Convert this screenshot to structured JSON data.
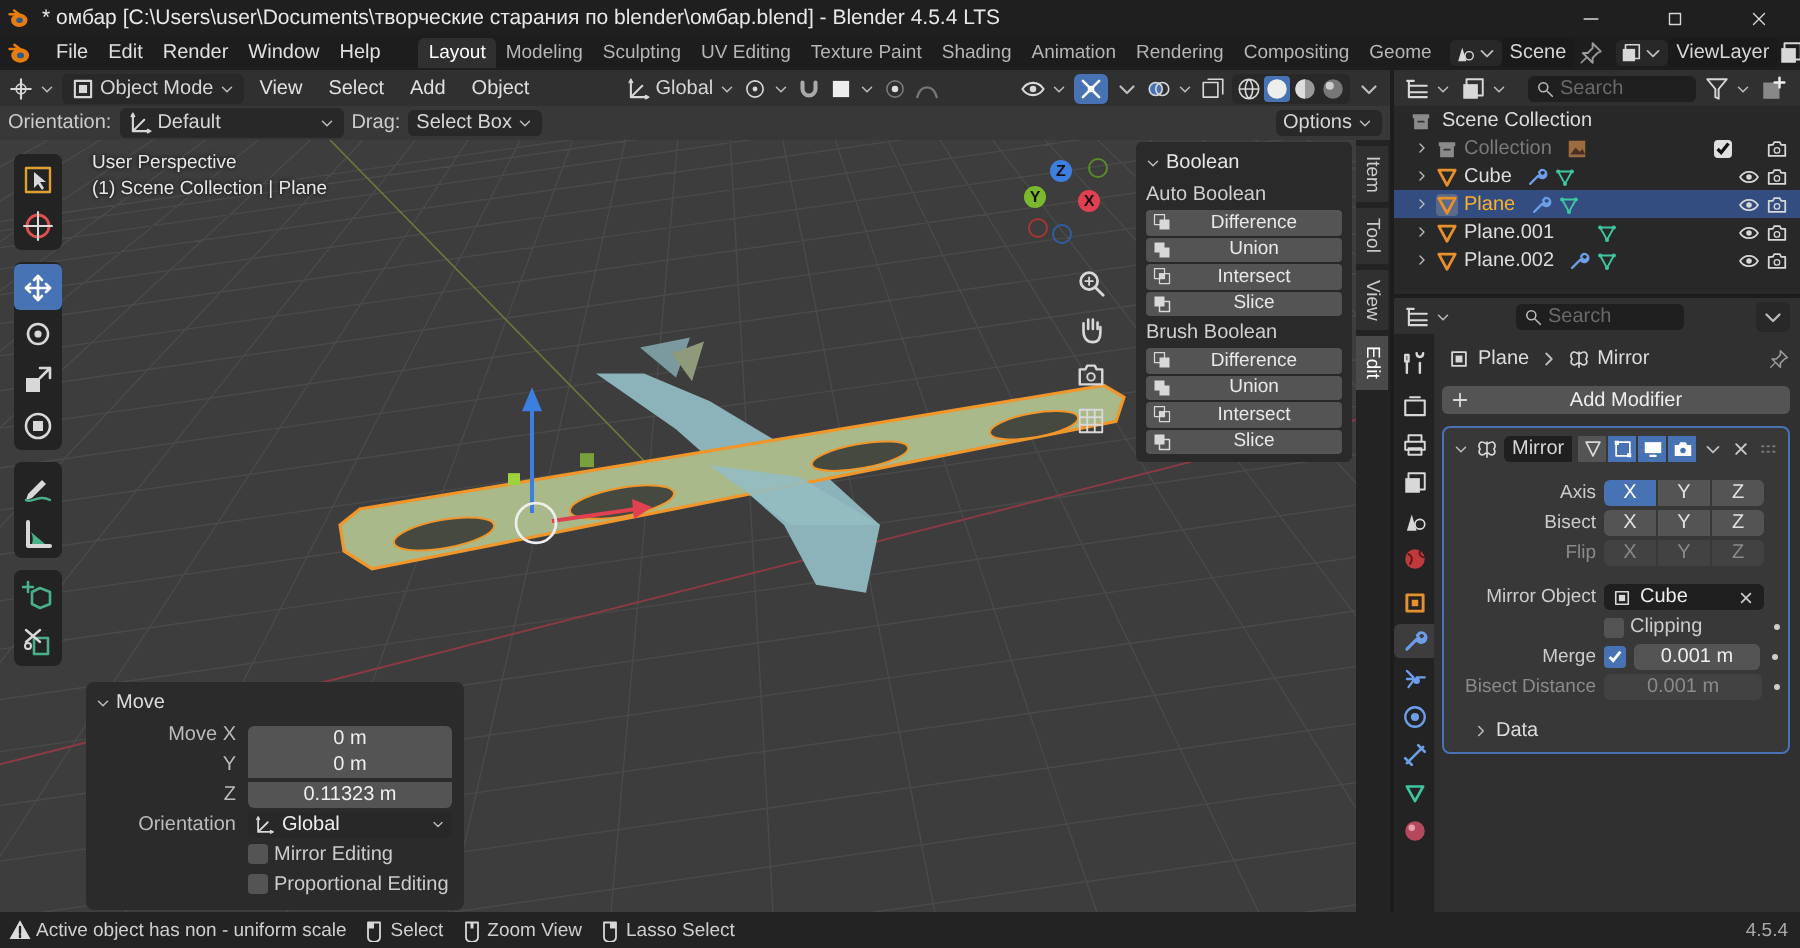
{
  "window": {
    "title": "* омбар [C:\\Users\\user\\Documents\\творческие старания по blender\\омбар.blend] - Blender 4.5.4 LTS"
  },
  "menu": [
    "File",
    "Edit",
    "Render",
    "Window",
    "Help"
  ],
  "workspaces": [
    {
      "label": "Layout",
      "selected": true
    },
    {
      "label": "Modeling",
      "selected": false
    },
    {
      "label": "Sculpting",
      "selected": false
    },
    {
      "label": "UV Editing",
      "selected": false
    },
    {
      "label": "Texture Paint",
      "selected": false
    },
    {
      "label": "Shading",
      "selected": false
    },
    {
      "label": "Animation",
      "selected": false
    },
    {
      "label": "Rendering",
      "selected": false
    },
    {
      "label": "Compositing",
      "selected": false
    },
    {
      "label": "Geome",
      "selected": false
    }
  ],
  "scene": {
    "name": "Scene"
  },
  "view_layer": {
    "name": "ViewLayer"
  },
  "viewport": {
    "mode": "Object Mode",
    "menus": [
      "View",
      "Select",
      "Add",
      "Object"
    ],
    "transform_orientation": "Global",
    "tool_settings": {
      "orientation_label": "Orientation:",
      "orientation": "Default",
      "drag_label": "Drag:",
      "drag": "Select Box",
      "options": "Options"
    },
    "tool_groups": [
      [
        {
          "kind": "select",
          "selected": false
        },
        {
          "kind": "cursor",
          "selected": false
        }
      ],
      [
        {
          "kind": "move",
          "selected": true
        },
        {
          "kind": "rotate",
          "selected": false
        },
        {
          "kind": "scale",
          "selected": false
        },
        {
          "kind": "transform",
          "selected": false
        }
      ],
      [
        {
          "kind": "annotate",
          "selected": false
        },
        {
          "kind": "measure",
          "selected": false
        }
      ],
      [
        {
          "kind": "add-cube",
          "selected": false
        },
        {
          "kind": "cut",
          "selected": false
        }
      ]
    ],
    "info": [
      "User Perspective",
      "(1) Scene Collection | Plane"
    ],
    "gizmo_axes": [
      "X",
      "Y",
      "Z"
    ],
    "sidebar": {
      "title": "Boolean",
      "sections": [
        {
          "title": "Auto Boolean",
          "buttons": [
            {
              "kind": "difference",
              "label": "Difference"
            },
            {
              "kind": "union",
              "label": "Union"
            },
            {
              "kind": "intersect",
              "label": "Intersect"
            },
            {
              "kind": "slice",
              "label": "Slice"
            }
          ]
        },
        {
          "title": "Brush Boolean",
          "buttons": [
            {
              "kind": "difference",
              "label": "Difference"
            },
            {
              "kind": "union",
              "label": "Union"
            },
            {
              "kind": "intersect",
              "label": "Intersect"
            },
            {
              "kind": "slice",
              "label": "Slice"
            }
          ]
        }
      ],
      "tabs": [
        {
          "label": "Item",
          "selected": false
        },
        {
          "label": "Tool",
          "selected": false
        },
        {
          "label": "View",
          "selected": false
        },
        {
          "label": "Edit",
          "selected": true
        }
      ]
    },
    "last_operator": {
      "title": "Move",
      "fields": [
        {
          "label": "Move X",
          "value": "0 m"
        },
        {
          "label": "Y",
          "value": "0 m"
        },
        {
          "label": "Z",
          "value": "0.11323 m"
        }
      ],
      "orientation_label": "Orientation",
      "orientation": "Global",
      "options": [
        {
          "label": "Mirror Editing",
          "checked": false
        },
        {
          "label": "Proportional Editing",
          "checked": false
        }
      ]
    }
  },
  "outliner": {
    "search": {
      "placeholder": "Search"
    },
    "tree": [
      {
        "name": "Scene Collection",
        "children": [
          {
            "name": "Collection",
            "kind": "collection",
            "selected": false,
            "disabled": true,
            "checked": true,
            "modifiers": false
          },
          {
            "name": "Cube",
            "kind": "mesh",
            "selected": false,
            "disabled": false,
            "modifiers": true
          },
          {
            "name": "Plane",
            "kind": "mesh",
            "selected": true,
            "disabled": false,
            "modifiers": true
          },
          {
            "name": "Plane.001",
            "kind": "mesh",
            "selected": false,
            "disabled": false,
            "modifiers": false
          },
          {
            "name": "Plane.002",
            "kind": "mesh",
            "selected": false,
            "disabled": false,
            "modifiers": true
          }
        ]
      }
    ]
  },
  "properties": {
    "search": {
      "placeholder": "Search"
    },
    "tab_groups": [
      [
        {
          "kind": "tool",
          "selected": false
        }
      ],
      [
        {
          "kind": "render",
          "selected": false
        },
        {
          "kind": "output",
          "selected": false
        },
        {
          "kind": "view-layer",
          "selected": false
        },
        {
          "kind": "scene",
          "selected": false
        },
        {
          "kind": "world",
          "selected": false
        }
      ],
      [
        {
          "kind": "object",
          "selected": false
        },
        {
          "kind": "modifiers",
          "selected": true
        },
        {
          "kind": "particles",
          "selected": false
        },
        {
          "kind": "physics",
          "selected": false
        },
        {
          "kind": "constraints",
          "selected": false
        },
        {
          "kind": "data",
          "selected": false
        },
        {
          "kind": "material",
          "selected": false
        }
      ]
    ],
    "breadcrumb": [
      "Plane",
      "Mirror"
    ],
    "add_modifier": "Add Modifier",
    "modifier": {
      "name": "Mirror",
      "expanded": true,
      "toggles": [
        {
          "kind": "on-cage",
          "on": false
        },
        {
          "kind": "edit-mode",
          "on": true
        },
        {
          "kind": "viewport",
          "on": true
        },
        {
          "kind": "render",
          "on": true
        }
      ],
      "rows": [
        {
          "label": "Axis",
          "disabled": false,
          "options": [
            {
              "label": "X",
              "selected": true
            },
            {
              "label": "Y",
              "selected": false
            },
            {
              "label": "Z",
              "selected": false
            }
          ]
        },
        {
          "label": "Bisect",
          "disabled": false,
          "options": [
            {
              "label": "X",
              "selected": false
            },
            {
              "label": "Y",
              "selected": false
            },
            {
              "label": "Z",
              "selected": false
            }
          ]
        },
        {
          "label": "Flip",
          "disabled": true,
          "options": [
            {
              "label": "X",
              "selected": false
            },
            {
              "label": "Y",
              "selected": false
            },
            {
              "label": "Z",
              "selected": false
            }
          ]
        }
      ],
      "mirror_object": {
        "label": "Mirror Object",
        "value": "Cube"
      },
      "clipping": {
        "label": "Clipping",
        "checked": false
      },
      "merge": {
        "label": "Merge",
        "checked": true,
        "value": "0.001 m"
      },
      "bisect_distance": {
        "label": "Bisect Distance",
        "value": "0.001 m",
        "disabled": true
      },
      "subpanels": [
        {
          "label": "Data",
          "expanded": false
        }
      ]
    }
  },
  "status_bar": {
    "message": "Active object has non - uniform scale",
    "hints": [
      {
        "kind": "left",
        "label": "Select"
      },
      {
        "kind": "middle",
        "label": "Zoom View"
      },
      {
        "kind": "right",
        "label": "Lasso Select"
      }
    ],
    "version": "4.5.4"
  }
}
